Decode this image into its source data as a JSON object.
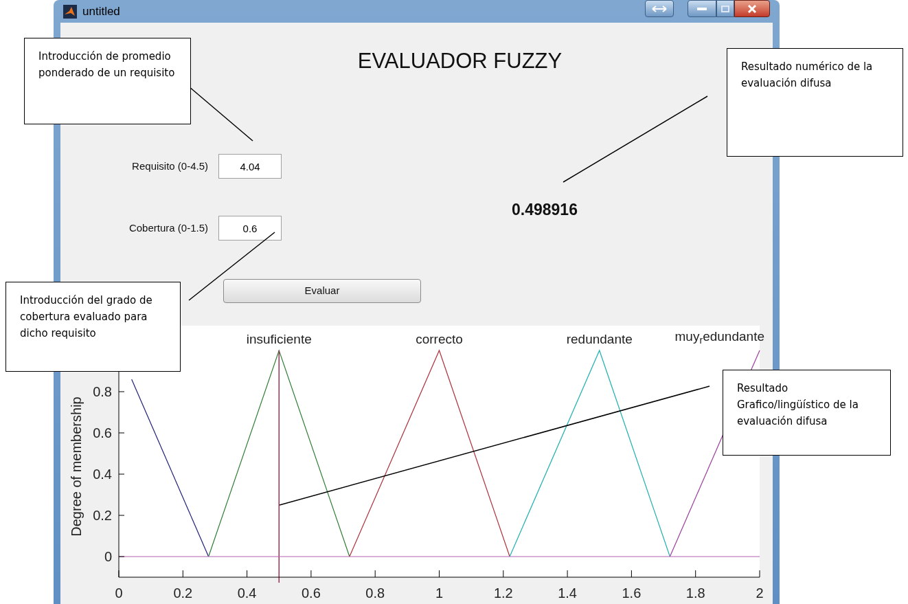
{
  "window": {
    "title": "untitled"
  },
  "form": {
    "title": "EVALUADOR FUZZY",
    "fields": [
      {
        "label": "Requisito (0-4.5)",
        "value": "4.04"
      },
      {
        "label": "Cobertura (0-1.5)",
        "value": "0.6"
      }
    ],
    "result": "0.498916",
    "button": "Evaluar"
  },
  "chart": {
    "chart_data": {
      "type": "line",
      "ylabel": "Degree of membership",
      "x": [
        0.04,
        0.28,
        0.5,
        0.72,
        1,
        1.22,
        1.5,
        1.72,
        2
      ],
      "series": [
        {
          "color": "#1f1f7a",
          "values": [
            0.86,
            0,
            null,
            null,
            null,
            null,
            null,
            null,
            null
          ]
        },
        {
          "name": "insuficiente",
          "color": "#2e7d32",
          "values": [
            null,
            0,
            1,
            0,
            null,
            null,
            null,
            null,
            null
          ]
        },
        {
          "name": "correcto",
          "color": "#b0303a",
          "values": [
            null,
            null,
            null,
            0,
            1,
            0,
            null,
            null,
            null
          ]
        },
        {
          "name": "redundante",
          "color": "#1fb0b0",
          "values": [
            null,
            null,
            null,
            null,
            null,
            0,
            1,
            0,
            null
          ]
        },
        {
          "name": "muy$_{r}$edundante",
          "color": "#9b3d9b",
          "values": [
            null,
            null,
            null,
            null,
            null,
            null,
            null,
            0,
            1
          ]
        }
      ],
      "xlim": [
        0,
        2
      ],
      "ylim": [
        -0.1,
        1.12
      ],
      "xticks": [
        0,
        0.2,
        0.4,
        0.6,
        0.8,
        1,
        1.2,
        1.4,
        1.6,
        1.8,
        2
      ],
      "yticks": [
        0,
        0.2,
        0.4,
        0.6,
        0.8
      ],
      "ref_lines": [
        {
          "axis": "x",
          "value": 0.5,
          "color": "#a0305a"
        },
        {
          "axis": "y",
          "value": 0,
          "color": "#b060b0"
        }
      ]
    }
  },
  "callouts": [
    {
      "text": "Introducción de promedio ponderado de un requisito"
    },
    {
      "text": "Resultado numérico de la evaluación difusa"
    },
    {
      "text": "Introducción del grado de cobertura evaluado para dicho requisito"
    },
    {
      "text": "Resultado Grafico/lingüístico de la evaluación difusa"
    }
  ]
}
